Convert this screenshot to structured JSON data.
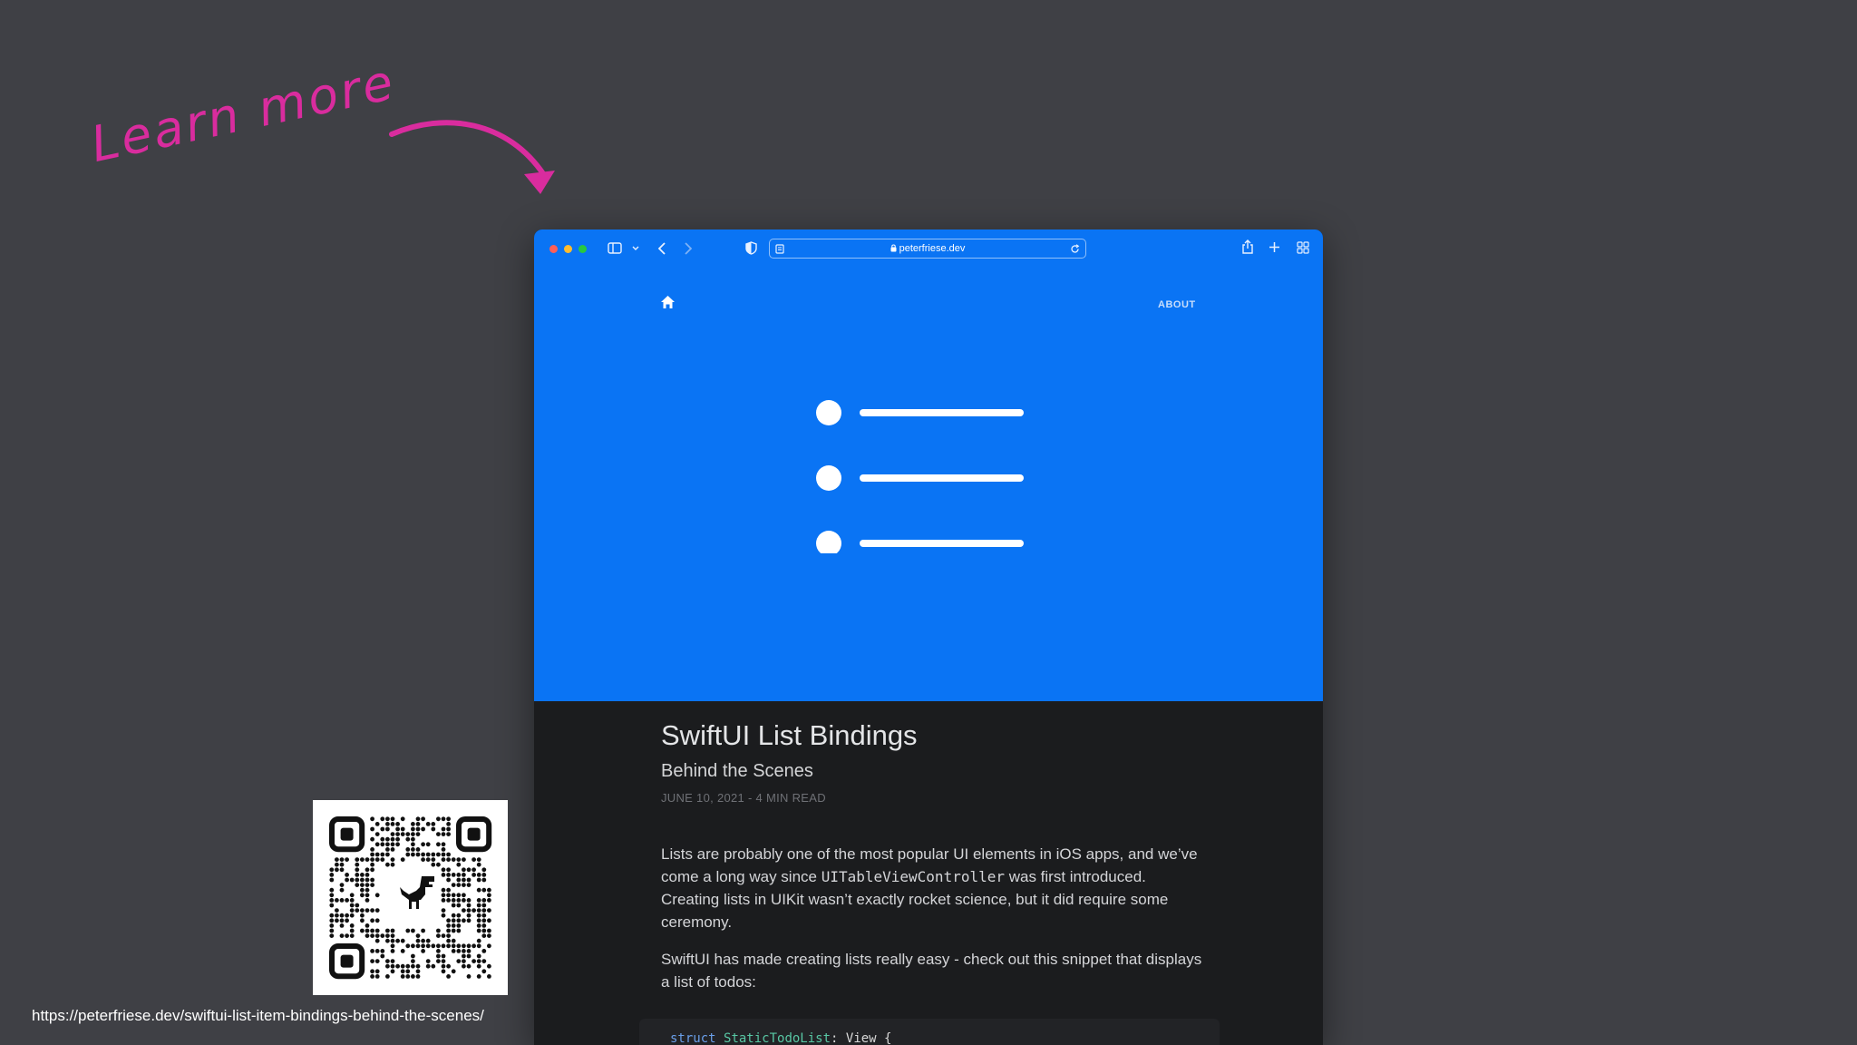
{
  "annotation": {
    "text": "Learn more",
    "color": "#d92c9e"
  },
  "browser": {
    "accent": "#0a74f4",
    "traffic_lights": [
      "#ff5f57",
      "#febc2e",
      "#28c840"
    ],
    "toolbar": {
      "icons": [
        "sidebar-icon",
        "chevron-down-icon",
        "back-icon",
        "forward-icon",
        "privacy-shield-icon",
        "reader-icon",
        "lock-icon",
        "reload-icon",
        "share-icon",
        "plus-icon",
        "tabs-grid-icon"
      ],
      "address": "peterfriese.dev"
    }
  },
  "site": {
    "nav": {
      "home_icon": "home-icon",
      "about": "ABOUT"
    },
    "hero": {
      "illustration": "list-icon"
    },
    "article": {
      "title": "SwiftUI List Bindings",
      "subtitle": "Behind the Scenes",
      "meta": "JUNE 10, 2021 - 4 MIN READ",
      "p1_before": "Lists are probably one of the most popular UI elements in iOS apps, and we’ve come a long way since ",
      "p1_code": "UITableViewController",
      "p1_after": " was first introduced. Creating lists in UIKit wasn’t exactly rocket science, but it did require some ceremony.",
      "p2": "SwiftUI has made creating lists really easy - check out this snippet that displays a list of todos:",
      "code": {
        "keyword": "struct",
        "type": "StaticTodoList",
        "rest": ": View {"
      }
    }
  },
  "qr": {
    "icon": "qr-code-icon",
    "center_icon": "dinosaur-icon"
  },
  "footer_url": "https://peterfriese.dev/swiftui-list-item-bindings-behind-the-scenes/"
}
